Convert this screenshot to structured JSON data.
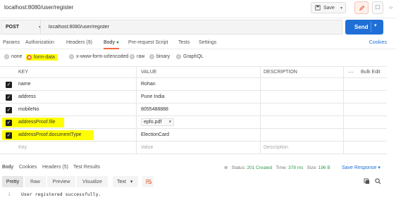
{
  "title_bar": {
    "request_title": "localhost:8080/user/register",
    "save_label": "Save",
    "more_label": "···"
  },
  "url_bar": {
    "method": "POST",
    "url": "localhost:8080/user/register",
    "send_label": "Send"
  },
  "request_tabs": [
    {
      "label": "Params"
    },
    {
      "label": "Authorization"
    },
    {
      "label": "Headers (9)"
    },
    {
      "label": "Body",
      "active": true
    },
    {
      "label": "Pre-request Script"
    },
    {
      "label": "Tests"
    },
    {
      "label": "Settings"
    }
  ],
  "cookies_label": "Cookies",
  "body_types": [
    {
      "label": "none"
    },
    {
      "label": "form-data",
      "selected": true
    },
    {
      "label": "x-www-form-urlencoded"
    },
    {
      "label": "raw"
    },
    {
      "label": "binary"
    },
    {
      "label": "GraphQL"
    }
  ],
  "table": {
    "headers": {
      "key": "KEY",
      "value": "VALUE",
      "description": "DESCRIPTION",
      "more": "···",
      "bulk_edit": "Bulk Edit"
    },
    "rows": [
      {
        "key": "name",
        "value": "Rohan",
        "description": "",
        "checked": true
      },
      {
        "key": "address",
        "value": "Pune India",
        "description": "",
        "checked": true
      },
      {
        "key": "mobileNo",
        "value": "8055488888",
        "description": "",
        "checked": true
      },
      {
        "key": "addressProof.file",
        "value": "epfo.pdf",
        "description": "",
        "checked": true,
        "is_file": true,
        "remove_label": "×"
      },
      {
        "key": "addressProof.documentType",
        "value": "ElectionCard",
        "description": "",
        "checked": true
      }
    ],
    "placeholder": {
      "key": "Key",
      "value": "Value",
      "description": "Description"
    }
  },
  "response_tabs": [
    {
      "label": "Body",
      "active": true
    },
    {
      "label": "Cookies"
    },
    {
      "label": "Headers (5)"
    },
    {
      "label": "Test Results"
    }
  ],
  "response_status": {
    "status_label": "Status:",
    "status_value": "201 Created",
    "time_label": "Time:",
    "time_value": "378 ms",
    "size_label": "Size:",
    "size_value": "196 B",
    "save_response": "Save Response"
  },
  "response_toolbar": {
    "views": [
      {
        "label": "Pretty",
        "active": true
      },
      {
        "label": "Raw"
      },
      {
        "label": "Preview"
      },
      {
        "label": "Visualize"
      }
    ],
    "format": "Text"
  },
  "response_body": {
    "line_number": "1",
    "text": "User registered successfully."
  },
  "colors": {
    "accent": "#f26b3a",
    "send_button": "#1f6fd6",
    "highlight": "#ffff00",
    "status_ok": "#2e9e4b"
  }
}
